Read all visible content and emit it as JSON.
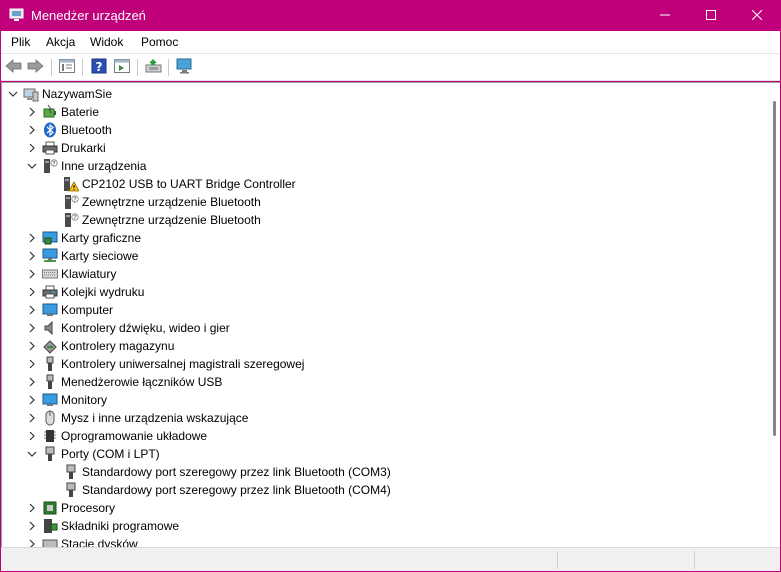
{
  "window": {
    "title": "Menedżer urządzeń",
    "accent": "#c0007a",
    "controls": [
      "minimize-icon",
      "maximize-icon",
      "close-icon"
    ]
  },
  "menu": {
    "items": [
      "Plik",
      "Akcja",
      "Widok",
      "Pomoc"
    ]
  },
  "toolbar": {
    "buttons": [
      "back-arrow-icon",
      "forward-arrow-icon",
      "properties-icon",
      "help-icon",
      "view-icon",
      "update-driver-icon",
      "monitor-icon"
    ]
  },
  "tree": {
    "root": "NazywamSie",
    "nodes": [
      {
        "label": "Baterie",
        "icon": "battery-icon",
        "expanded": false
      },
      {
        "label": "Bluetooth",
        "icon": "bluetooth-icon",
        "expanded": false
      },
      {
        "label": "Drukarki",
        "icon": "printer-icon",
        "expanded": false
      },
      {
        "label": "Inne urządzenia",
        "icon": "unknown-device-icon",
        "expanded": true,
        "children": [
          {
            "label": "CP2102 USB to UART Bridge Controller",
            "icon": "warning-device-icon"
          },
          {
            "label": "Zewnętrzne urządzenie Bluetooth",
            "icon": "unknown-device-icon"
          },
          {
            "label": "Zewnętrzne urządzenie Bluetooth",
            "icon": "unknown-device-icon"
          }
        ]
      },
      {
        "label": "Karty graficzne",
        "icon": "display-adapter-icon",
        "expanded": false
      },
      {
        "label": "Karty sieciowe",
        "icon": "network-adapter-icon",
        "expanded": false
      },
      {
        "label": "Klawiatury",
        "icon": "keyboard-icon",
        "expanded": false
      },
      {
        "label": "Kolejki wydruku",
        "icon": "print-queue-icon",
        "expanded": false
      },
      {
        "label": "Komputer",
        "icon": "computer-icon",
        "expanded": false
      },
      {
        "label": "Kontrolery dźwięku, wideo i gier",
        "icon": "speaker-icon",
        "expanded": false
      },
      {
        "label": "Kontrolery magazynu",
        "icon": "storage-controller-icon",
        "expanded": false
      },
      {
        "label": "Kontrolery uniwersalnej magistrali szeregowej",
        "icon": "usb-icon",
        "expanded": false
      },
      {
        "label": "Menedżerowie łączników USB",
        "icon": "usb-connector-icon",
        "expanded": false
      },
      {
        "label": "Monitory",
        "icon": "monitor-icon",
        "expanded": false
      },
      {
        "label": "Mysz i inne urządzenia wskazujące",
        "icon": "mouse-icon",
        "expanded": false
      },
      {
        "label": "Oprogramowanie układowe",
        "icon": "firmware-icon",
        "expanded": false
      },
      {
        "label": "Porty (COM i LPT)",
        "icon": "port-icon",
        "expanded": true,
        "children": [
          {
            "label": "Standardowy port szeregowy przez link Bluetooth (COM3)",
            "icon": "port-icon"
          },
          {
            "label": "Standardowy port szeregowy przez link Bluetooth (COM4)",
            "icon": "port-icon"
          }
        ]
      },
      {
        "label": "Procesory",
        "icon": "processor-icon",
        "expanded": false
      },
      {
        "label": "Składniki programowe",
        "icon": "software-component-icon",
        "expanded": false
      },
      {
        "label": "Stacje dysków",
        "icon": "disk-drive-icon",
        "expanded": false
      }
    ]
  }
}
